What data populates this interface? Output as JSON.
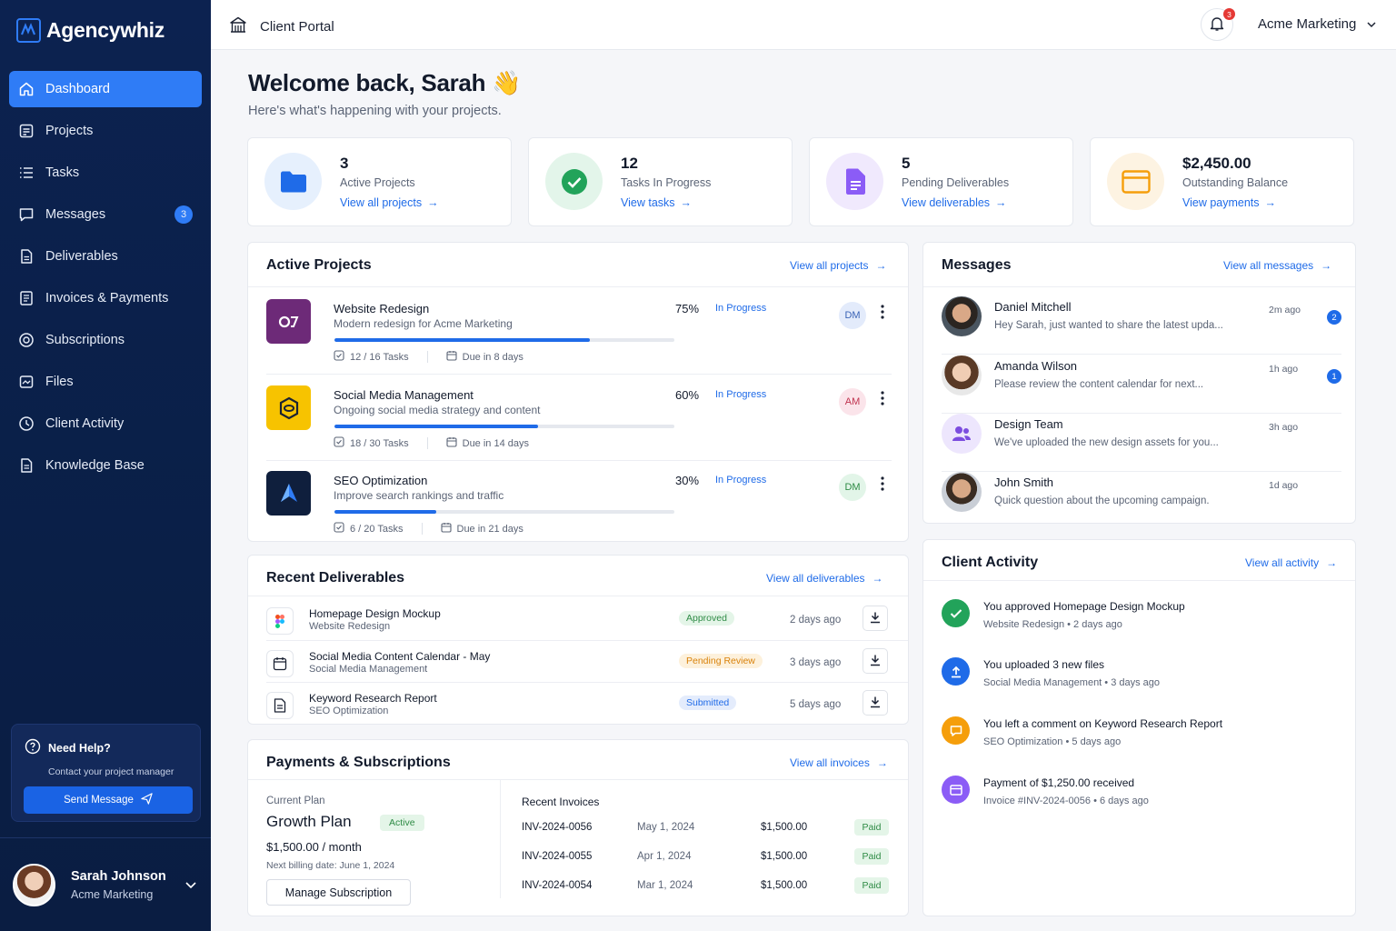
{
  "brand": {
    "name": "Agencywhiz"
  },
  "sidebar": {
    "items": [
      {
        "label": "Dashboard",
        "icon": "home-icon"
      },
      {
        "label": "Projects",
        "icon": "projects-icon"
      },
      {
        "label": "Tasks",
        "icon": "list-icon"
      },
      {
        "label": "Messages",
        "icon": "message-icon",
        "badge": "3"
      },
      {
        "label": "Deliverables",
        "icon": "file-icon"
      },
      {
        "label": "Invoices & Payments",
        "icon": "invoice-icon"
      },
      {
        "label": "Subscriptions",
        "icon": "subscription-icon"
      },
      {
        "label": "Files",
        "icon": "files-icon"
      },
      {
        "label": "Client Activity",
        "icon": "activity-icon"
      },
      {
        "label": "Knowledge Base",
        "icon": "book-icon"
      }
    ],
    "help": {
      "title": "Need Help?",
      "subtitle": "Contact your project manager",
      "button": "Send Message"
    },
    "profile": {
      "name": "Sarah Johnson",
      "org": "Acme Marketing"
    }
  },
  "topbar": {
    "title": "Client Portal",
    "notifications": "3",
    "org": "Acme Marketing"
  },
  "welcome": {
    "title": "Welcome back, Sarah 👋",
    "subtitle": "Here's what's happening with your projects."
  },
  "stats": [
    {
      "value": "3",
      "label": "Active Projects",
      "link": "View all projects"
    },
    {
      "value": "12",
      "label": "Tasks In Progress",
      "link": "View tasks"
    },
    {
      "value": "5",
      "label": "Pending Deliverables",
      "link": "View deliverables"
    },
    {
      "value": "$2,450.00",
      "label": "Outstanding Balance",
      "link": "View payments"
    }
  ],
  "projects": {
    "title": "Active Projects",
    "link": "View all projects",
    "items": [
      {
        "name": "Website Redesign",
        "desc": "Modern redesign for Acme Marketing",
        "percent": "75%",
        "progress": 0.75,
        "status": "In Progress",
        "tasks": "12 / 16 Tasks",
        "due": "Due in 8 days",
        "owner": "DM"
      },
      {
        "name": "Social Media Management",
        "desc": "Ongoing social media strategy and content",
        "percent": "60%",
        "progress": 0.6,
        "status": "In Progress",
        "tasks": "18 / 30 Tasks",
        "due": "Due in 14 days",
        "owner": "AM"
      },
      {
        "name": "SEO Optimization",
        "desc": "Improve search rankings and traffic",
        "percent": "30%",
        "progress": 0.3,
        "status": "In Progress",
        "tasks": "6 / 20 Tasks",
        "due": "Due in 21 days",
        "owner": "DM"
      }
    ]
  },
  "deliverables": {
    "title": "Recent Deliverables",
    "link": "View all deliverables",
    "items": [
      {
        "name": "Homepage Design Mockup",
        "project": "Website Redesign",
        "status": "Approved",
        "when": "2 days ago"
      },
      {
        "name": "Social Media Content Calendar - May",
        "project": "Social Media Management",
        "status": "Pending Review",
        "when": "3 days ago"
      },
      {
        "name": "Keyword Research Report",
        "project": "SEO Optimization",
        "status": "Submitted",
        "when": "5 days ago"
      }
    ]
  },
  "payments": {
    "title": "Payments & Subscriptions",
    "link": "View all invoices",
    "plan": {
      "label": "Current Plan",
      "name": "Growth Plan",
      "status": "Active",
      "price": "$1,500.00 / month",
      "next": "Next billing date: June 1, 2024",
      "button": "Manage Subscription"
    },
    "invoices_title": "Recent Invoices",
    "invoices": [
      {
        "id": "INV-2024-0056",
        "date": "May 1, 2024",
        "amount": "$1,500.00",
        "status": "Paid"
      },
      {
        "id": "INV-2024-0055",
        "date": "Apr 1, 2024",
        "amount": "$1,500.00",
        "status": "Paid"
      },
      {
        "id": "INV-2024-0054",
        "date": "Mar 1, 2024",
        "amount": "$1,500.00",
        "status": "Paid"
      }
    ]
  },
  "messages": {
    "title": "Messages",
    "link": "View all messages",
    "items": [
      {
        "name": "Daniel Mitchell",
        "preview": "Hey Sarah, just wanted to share the latest upda...",
        "time": "2m ago",
        "badge": "2"
      },
      {
        "name": "Amanda Wilson",
        "preview": "Please review the content calendar for next...",
        "time": "1h ago",
        "badge": "1"
      },
      {
        "name": "Design Team",
        "preview": "We've uploaded the new design assets for you...",
        "time": "3h ago"
      },
      {
        "name": "John Smith",
        "preview": "Quick question about the upcoming campaign.",
        "time": "1d ago"
      }
    ]
  },
  "activity": {
    "title": "Client Activity",
    "link": "View all activity",
    "items": [
      {
        "text": "You approved Homepage Design Mockup",
        "project": "Website Redesign",
        "when": "2 days ago"
      },
      {
        "text": "You uploaded 3 new files",
        "project": "Social Media Management",
        "when": "3 days ago"
      },
      {
        "text": "You left a comment on Keyword Research Report",
        "project": "SEO Optimization",
        "when": "5 days ago"
      },
      {
        "text": "Payment of $1,250.00 received",
        "project": "Invoice #INV-2024-0056",
        "when": "6 days ago"
      }
    ]
  },
  "colors": {
    "accent": "#2f7cf6",
    "sidebar": "#0c2250",
    "success": "#22a35a",
    "warning": "#f59e0b",
    "purple": "#8b5cf6"
  }
}
